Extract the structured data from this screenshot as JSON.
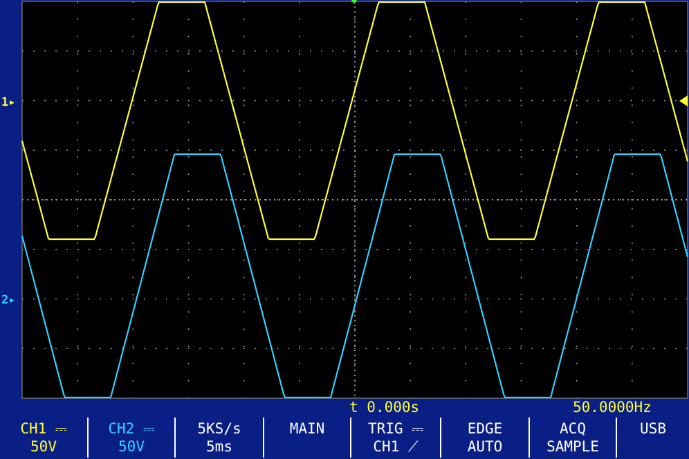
{
  "display": {
    "ch1_marker": "1▸",
    "ch2_marker": "2▸",
    "trigger_position": "t 0.000s",
    "frequency": "50.0000Hz",
    "colors": {
      "ch1": "#ffff33",
      "ch2": "#33d0ff",
      "grid": "#9a9a9a",
      "background": "#000000",
      "frame": "#0a1f86"
    }
  },
  "softkeys": [
    {
      "line1": "CH1 ⎓",
      "line2": "50V"
    },
    {
      "line1": "CH2 ⎓",
      "line2": "50V"
    },
    {
      "line1": "5KS/s",
      "line2": "5ms"
    },
    {
      "line1": "MAIN",
      "line2": ""
    },
    {
      "line1": "TRIG ⎓",
      "line2": "CH1 ⟋"
    },
    {
      "line1": "EDGE",
      "line2": "AUTO"
    },
    {
      "line1": "ACQ",
      "line2": "SAMPLE"
    },
    {
      "line1": "USB",
      "line2": ""
    }
  ]
}
